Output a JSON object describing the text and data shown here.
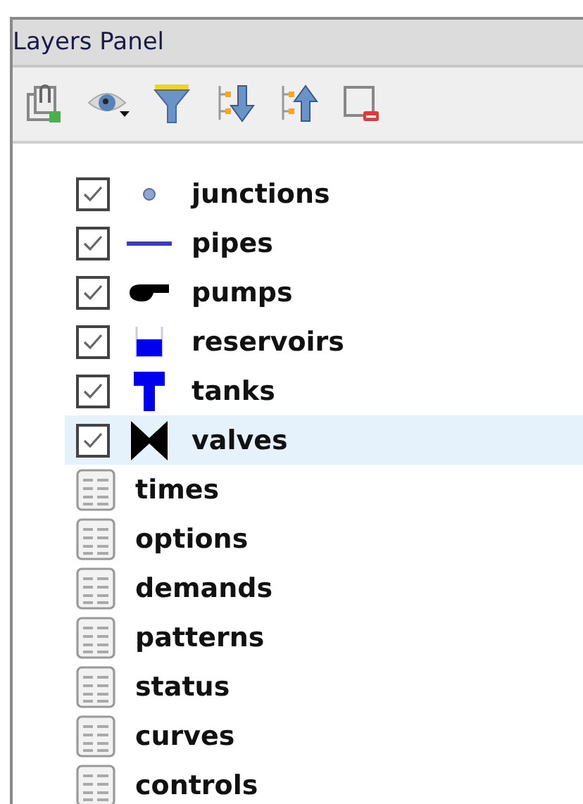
{
  "panel": {
    "title": "Layers Panel"
  },
  "toolbar": [
    {
      "kind": "add-group"
    },
    {
      "kind": "visibility"
    },
    {
      "kind": "filter"
    },
    {
      "kind": "expand"
    },
    {
      "kind": "collapse"
    },
    {
      "kind": "remove"
    }
  ],
  "layers": [
    {
      "kind": "point",
      "label": "junctions",
      "checked": true,
      "selected": false
    },
    {
      "kind": "line",
      "label": "pipes",
      "checked": true,
      "selected": false
    },
    {
      "kind": "pump",
      "label": "pumps",
      "checked": true,
      "selected": false
    },
    {
      "kind": "reservoir",
      "label": "reservoirs",
      "checked": true,
      "selected": false
    },
    {
      "kind": "tank",
      "label": "tanks",
      "checked": true,
      "selected": false
    },
    {
      "kind": "valve",
      "label": "valves",
      "checked": true,
      "selected": true
    },
    {
      "kind": "table",
      "label": "times",
      "selected": false
    },
    {
      "kind": "table",
      "label": "options",
      "selected": false
    },
    {
      "kind": "table",
      "label": "demands",
      "selected": false
    },
    {
      "kind": "table",
      "label": "patterns",
      "selected": false
    },
    {
      "kind": "table",
      "label": "status",
      "selected": false
    },
    {
      "kind": "table",
      "label": "curves",
      "selected": false
    },
    {
      "kind": "table",
      "label": "controls",
      "selected": false
    }
  ]
}
